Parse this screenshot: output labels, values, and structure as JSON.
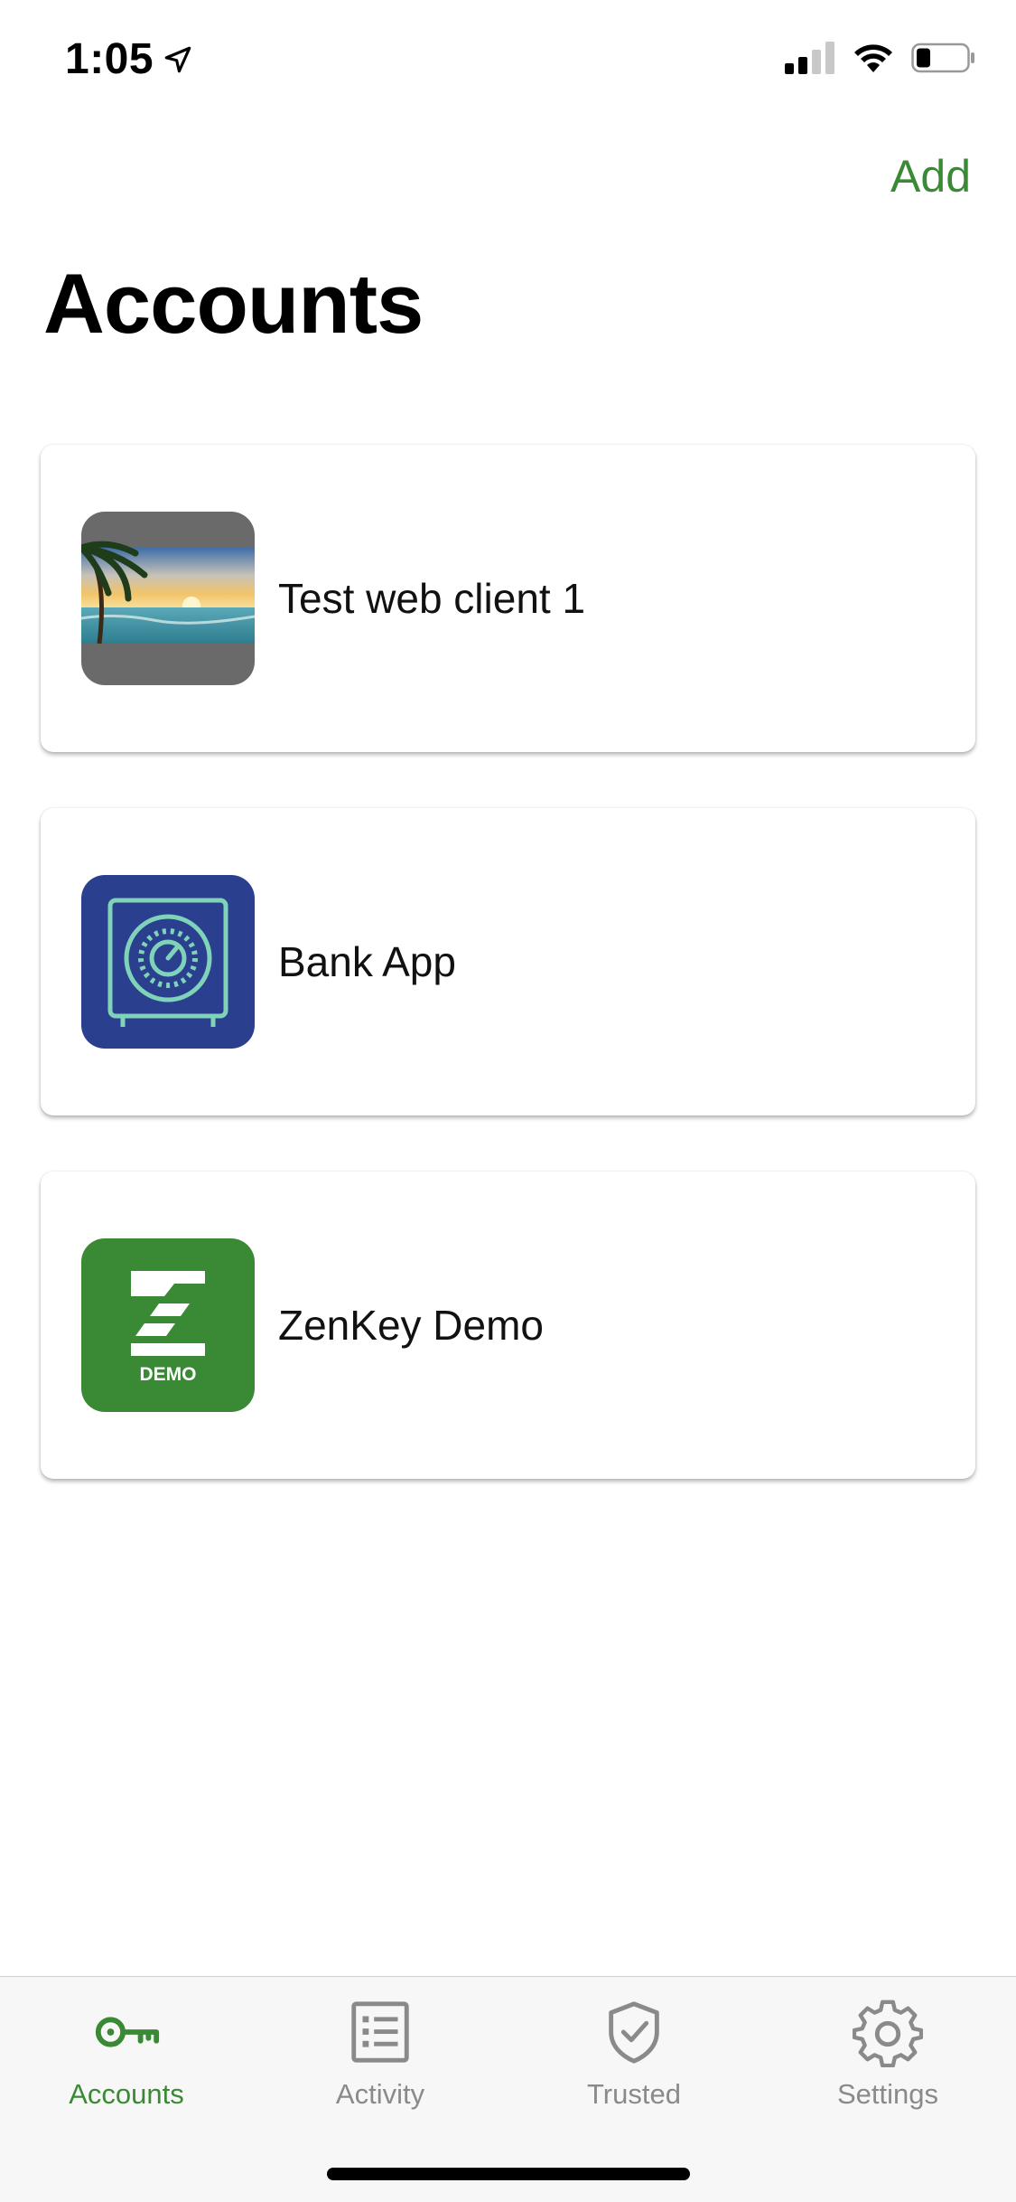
{
  "status_bar": {
    "time": "1:05",
    "location_icon": "location-arrow-icon",
    "signal_icon": "cellular-signal-icon",
    "wifi_icon": "wifi-icon",
    "battery_icon": "battery-icon"
  },
  "header": {
    "add_label": "Add",
    "title": "Accounts"
  },
  "accounts": [
    {
      "name": "Test web client 1",
      "icon": "beach-photo-icon"
    },
    {
      "name": "Bank App",
      "icon": "vault-safe-icon"
    },
    {
      "name": "ZenKey Demo",
      "icon": "zenkey-demo-logo",
      "logo_text": "DEMO"
    }
  ],
  "tabs": [
    {
      "label": "Accounts",
      "icon": "key-icon",
      "active": true
    },
    {
      "label": "Activity",
      "icon": "list-icon",
      "active": false
    },
    {
      "label": "Trusted",
      "icon": "shield-check-icon",
      "active": false
    },
    {
      "label": "Settings",
      "icon": "gear-icon",
      "active": false
    }
  ],
  "colors": {
    "accent": "#3a8a35",
    "inactive_tab": "#8a8a8a",
    "bank_icon_bg": "#2b3f8f",
    "bank_icon_line": "#7fd3b8",
    "zenkey_bg": "#3a8a35"
  }
}
